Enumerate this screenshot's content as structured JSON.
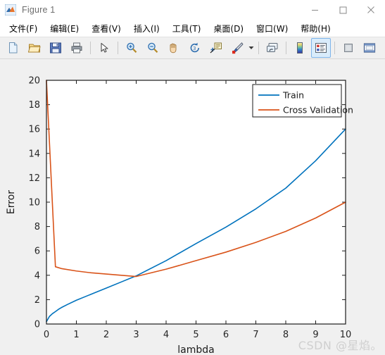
{
  "window": {
    "title": "Figure 1",
    "app_icon": "matlab-figure-icon",
    "minimize_label": "—",
    "maximize_label": "□",
    "close_label": "✕"
  },
  "menubar": {
    "items": [
      {
        "label": "文件(F)",
        "name": "menu-file"
      },
      {
        "label": "编辑(E)",
        "name": "menu-edit"
      },
      {
        "label": "查看(V)",
        "name": "menu-view"
      },
      {
        "label": "插入(I)",
        "name": "menu-insert"
      },
      {
        "label": "工具(T)",
        "name": "menu-tools"
      },
      {
        "label": "桌面(D)",
        "name": "menu-desktop"
      },
      {
        "label": "窗口(W)",
        "name": "menu-window"
      },
      {
        "label": "帮助(H)",
        "name": "menu-help"
      }
    ]
  },
  "toolbar": {
    "buttons": [
      {
        "name": "new-figure-icon",
        "tooltip": "New Figure"
      },
      {
        "name": "open-file-icon",
        "tooltip": "Open File"
      },
      {
        "name": "save-figure-icon",
        "tooltip": "Save Figure"
      },
      {
        "name": "print-figure-icon",
        "tooltip": "Print Figure"
      },
      {
        "name": "edit-plot-pointer-icon",
        "tooltip": "Edit Plot"
      },
      {
        "name": "zoom-in-icon",
        "tooltip": "Zoom In"
      },
      {
        "name": "zoom-out-icon",
        "tooltip": "Zoom Out"
      },
      {
        "name": "pan-hand-icon",
        "tooltip": "Pan"
      },
      {
        "name": "rotate-3d-icon",
        "tooltip": "Rotate 3D"
      },
      {
        "name": "data-cursor-icon",
        "tooltip": "Data Cursor"
      },
      {
        "name": "brush-data-icon",
        "tooltip": "Brush/Select Data"
      },
      {
        "name": "brush-dropdown-caret-icon",
        "tooltip": "Brush Options"
      },
      {
        "name": "link-plot-icon",
        "tooltip": "Link Plot"
      },
      {
        "name": "colorbar-icon",
        "tooltip": "Insert Colorbar"
      },
      {
        "name": "legend-icon",
        "tooltip": "Insert Legend",
        "active": true
      },
      {
        "name": "hide-plot-tools-icon",
        "tooltip": "Hide Plot Tools"
      },
      {
        "name": "show-plot-tools-icon",
        "tooltip": "Show Plot Tools and Dock Figure"
      }
    ]
  },
  "figure": {
    "watermark": "CSDN @星焰。"
  },
  "chart_data": {
    "type": "line",
    "title": "",
    "xlabel": "lambda",
    "ylabel": "Error",
    "xlim": [
      0,
      10
    ],
    "ylim": [
      0,
      20
    ],
    "xticks": [
      0,
      1,
      2,
      3,
      4,
      5,
      6,
      7,
      8,
      9,
      10
    ],
    "yticks": [
      0,
      2,
      4,
      6,
      8,
      10,
      12,
      14,
      16,
      18,
      20
    ],
    "grid": false,
    "legend_position": "upper right",
    "colors": {
      "train": "#0072BD",
      "cross_validation": "#D95319"
    },
    "series": [
      {
        "name": "Train",
        "color": "#0072BD",
        "x": [
          0,
          0.1,
          0.2,
          0.3,
          0.4,
          0.5,
          0.7,
          1.0,
          1.3,
          1.6,
          2.0,
          2.5,
          3.0,
          4.0,
          5.0,
          6.0,
          7.0,
          8.0,
          9.0,
          10.0
        ],
        "y": [
          0.2,
          0.62,
          0.85,
          1.02,
          1.2,
          1.35,
          1.6,
          1.95,
          2.25,
          2.55,
          2.95,
          3.45,
          3.95,
          5.2,
          6.6,
          7.95,
          9.45,
          11.15,
          13.4,
          16.0
        ]
      },
      {
        "name": "Cross Validation",
        "color": "#D95319",
        "x": [
          0,
          0.3,
          0.5,
          1.0,
          1.5,
          2.0,
          2.5,
          3.0,
          4.0,
          5.0,
          6.0,
          7.0,
          8.0,
          9.0,
          10.0
        ],
        "y": [
          20.0,
          4.7,
          4.55,
          4.35,
          4.2,
          4.1,
          4.0,
          3.9,
          4.5,
          5.2,
          5.9,
          6.7,
          7.6,
          8.7,
          10.0
        ]
      }
    ]
  },
  "legend": {
    "entries": [
      {
        "label": "Train",
        "color": "#0072BD"
      },
      {
        "label": "Cross Validation",
        "color": "#D95319"
      }
    ]
  }
}
